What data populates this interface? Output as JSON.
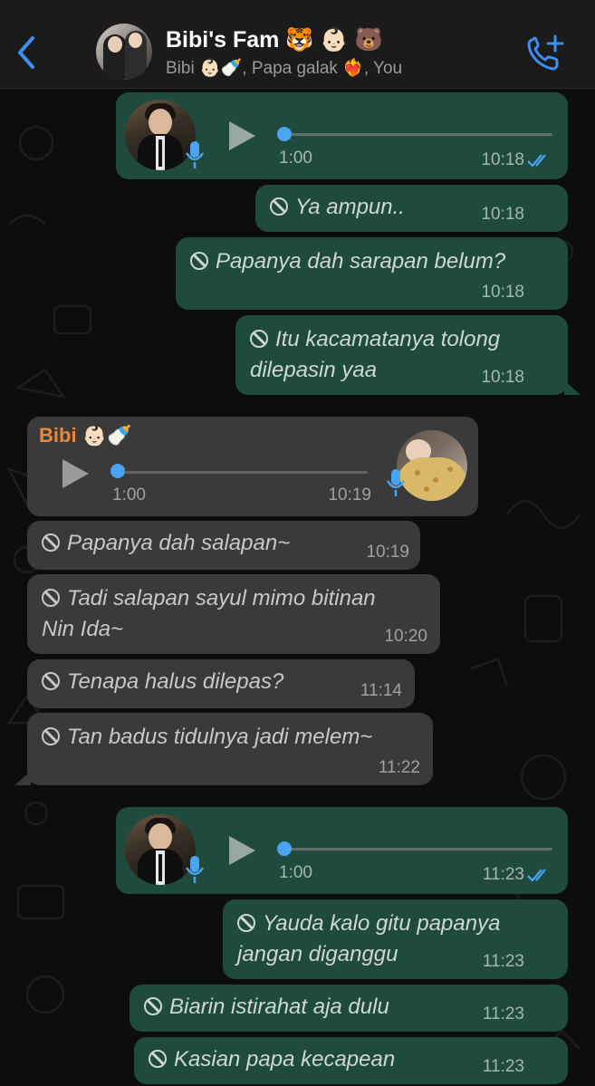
{
  "header": {
    "back_icon": "chevron-left-icon",
    "title": "Bibi's Fam 🐯 👶🏻 🐻",
    "subtitle": "Bibi 👶🏻🍼, Papa galak ❤️‍🔥, You",
    "call_icon": "add-call-icon"
  },
  "colors": {
    "accent": "#4aa4f0",
    "outgoing_bubble": "#1f4b3f",
    "incoming_bubble": "#3a3a3a",
    "sender_name": "#e8893b"
  },
  "messages": [
    {
      "type": "voice",
      "direction": "out",
      "duration": "1:00",
      "time": "10:18",
      "read": true
    },
    {
      "type": "deleted",
      "direction": "out",
      "text": "Ya ampun..",
      "time": "10:18"
    },
    {
      "type": "deleted",
      "direction": "out",
      "text": "Papanya dah sarapan belum?",
      "time": "10:18"
    },
    {
      "type": "deleted",
      "direction": "out",
      "text_line1": "Itu kacamatanya tolong",
      "text_line2": "dilepasin yaa",
      "time": "10:18"
    },
    {
      "type": "voice",
      "direction": "in",
      "sender": "Bibi 👶🏻🍼",
      "duration": "1:00",
      "time": "10:19"
    },
    {
      "type": "deleted",
      "direction": "in",
      "text": "Papanya dah salapan~",
      "time": "10:19"
    },
    {
      "type": "deleted",
      "direction": "in",
      "text_line1": "Tadi salapan sayul mimo bitinan",
      "text_line2": "Nin Ida~",
      "time": "10:20"
    },
    {
      "type": "deleted",
      "direction": "in",
      "text": "Tenapa halus dilepas?",
      "time": "11:14"
    },
    {
      "type": "deleted",
      "direction": "in",
      "text": "Tan badus tidulnya jadi melem~",
      "time": "11:22"
    },
    {
      "type": "voice",
      "direction": "out",
      "duration": "1:00",
      "time": "11:23",
      "read": true
    },
    {
      "type": "deleted",
      "direction": "out",
      "text_line1": "Yauda kalo gitu papanya",
      "text_line2": "jangan diganggu",
      "time": "11:23"
    },
    {
      "type": "deleted",
      "direction": "out",
      "text": "Biarin istirahat aja dulu",
      "time": "11:23"
    },
    {
      "type": "deleted",
      "direction": "out",
      "text": "Kasian papa kecapean",
      "time": "11:23"
    }
  ]
}
